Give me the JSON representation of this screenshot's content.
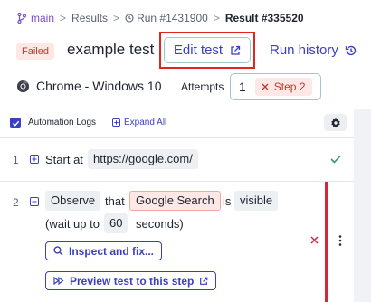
{
  "breadcrumb": {
    "branch": "main",
    "results": "Results",
    "separator": ">",
    "run": "Run #1431900",
    "current": "Result #335520"
  },
  "header": {
    "status_badge": "Failed",
    "test_title": "example test",
    "edit_label": "Edit test",
    "run_history_label": "Run history"
  },
  "environment": {
    "browser": "Chrome - Windows 10",
    "attempts_label": "Attempts",
    "attempt_number": "1",
    "failed_step_chip": "Step 2"
  },
  "toolbar": {
    "automation_logs_label": "Automation Logs",
    "automation_logs_checked": true,
    "expand_all_label": "Expand All"
  },
  "steps": [
    {
      "number": "1",
      "verb": "Start at",
      "url": "https://google.com/",
      "status": "passed"
    },
    {
      "number": "2",
      "action": "Observe",
      "that": "that",
      "element": "Google Search",
      "is": "is",
      "state": "visible",
      "wait_prefix": "(wait up to",
      "wait_seconds": "60",
      "wait_suffix": "seconds)",
      "status": "failed",
      "inspect_label": "Inspect and fix...",
      "preview_label": "Preview test to this step"
    }
  ],
  "colors": {
    "accent": "#3a3fc4",
    "failed": "#c0392b",
    "passed": "#2e9d5e",
    "highlight_box": "#e2261b",
    "branch": "#7a4fc4"
  }
}
